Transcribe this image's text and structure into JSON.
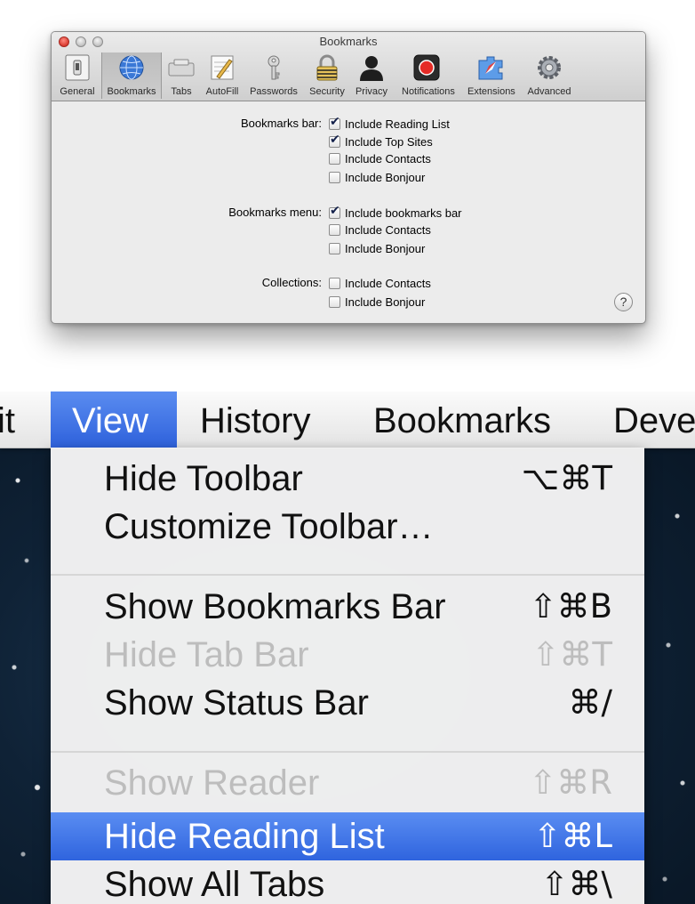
{
  "prefs_window": {
    "title": "Bookmarks",
    "toolbar": [
      {
        "label": "General"
      },
      {
        "label": "Bookmarks",
        "selected": true
      },
      {
        "label": "Tabs"
      },
      {
        "label": "AutoFill"
      },
      {
        "label": "Passwords"
      },
      {
        "label": "Security"
      },
      {
        "label": "Privacy"
      },
      {
        "label": "Notifications"
      },
      {
        "label": "Extensions"
      },
      {
        "label": "Advanced"
      }
    ],
    "groups": [
      {
        "label": "Bookmarks bar:",
        "options": [
          {
            "label": "Include Reading List",
            "checked": true
          },
          {
            "label": "Include Top Sites",
            "checked": true
          },
          {
            "label": "Include Contacts",
            "checked": false
          },
          {
            "label": "Include Bonjour",
            "checked": false
          }
        ]
      },
      {
        "label": "Bookmarks menu:",
        "options": [
          {
            "label": "Include bookmarks bar",
            "checked": true
          },
          {
            "label": "Include Contacts",
            "checked": false
          },
          {
            "label": "Include Bonjour",
            "checked": false
          }
        ]
      },
      {
        "label": "Collections:",
        "options": [
          {
            "label": "Include Contacts",
            "checked": false
          },
          {
            "label": "Include Bonjour",
            "checked": false
          }
        ]
      }
    ],
    "help_symbol": "?"
  },
  "menubar": {
    "titles": [
      "it",
      "View",
      "History",
      "Bookmarks",
      "Deve"
    ],
    "open_menu": "View"
  },
  "view_menu": {
    "items": [
      {
        "label": "Hide Toolbar",
        "shortcut": "⌥⌘T",
        "enabled": true
      },
      {
        "label": "Customize Toolbar…",
        "shortcut": "",
        "enabled": true
      },
      {
        "label": "Show Bookmarks Bar",
        "shortcut": "⇧⌘B",
        "enabled": true
      },
      {
        "label": "Hide Tab Bar",
        "shortcut": "⇧⌘T",
        "enabled": false
      },
      {
        "label": "Show Status Bar",
        "shortcut": "⌘/",
        "enabled": true
      },
      {
        "label": "Show Reader",
        "shortcut": "⇧⌘R",
        "enabled": false
      },
      {
        "label": "Hide Reading List",
        "shortcut": "⇧⌘L",
        "enabled": true,
        "highlighted": true
      },
      {
        "label": "Show All Tabs",
        "shortcut": "⇧⌘\\",
        "enabled": true
      }
    ]
  },
  "colors": {
    "selection_blue": "#3a6ee0",
    "window_bg": "#ececec",
    "desktop_bg": "#0f2236",
    "disabled_text": "#bdbdbd"
  },
  "icons": [
    "general-switch-icon",
    "globe-icon",
    "tabs-icon",
    "autofill-pencil-icon",
    "key-icon",
    "padlock-icon",
    "person-silhouette-icon",
    "notifications-icon",
    "extensions-compass-icon",
    "gear-icon",
    "help-icon"
  ]
}
